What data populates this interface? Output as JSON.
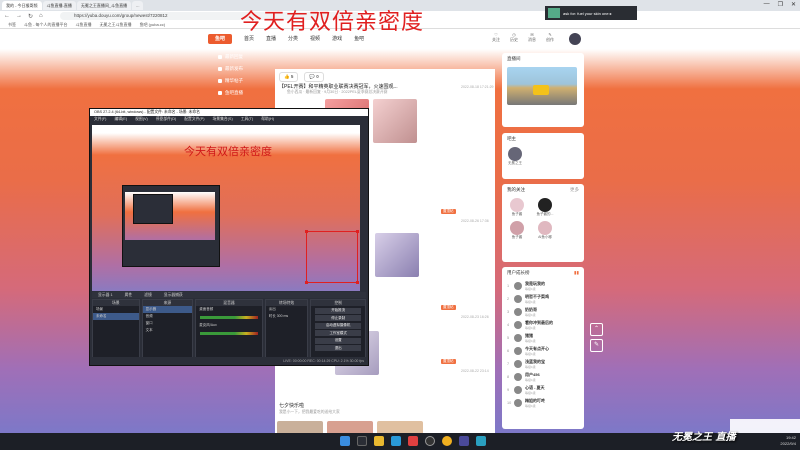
{
  "browser": {
    "tabs": [
      "我的 - 今日猴哥频",
      "斗鱼直播-直播",
      "无冕之王直播间_斗鱼直播",
      "..."
    ],
    "url": "https://yuba.douyu.com/group/newest/7220812",
    "bookmarks": [
      "书签",
      "斗鱼 - 每个人的直播平台",
      "斗鱼直播",
      "无冕之王斗鱼直播",
      "鱼吧 (yuba.cc)"
    ],
    "win_controls": [
      "—",
      "❐",
      "✕"
    ]
  },
  "overlay_title": "今天有双倍亲密度",
  "site": {
    "logo": "鱼吧",
    "nav": [
      "首页",
      "直播",
      "分类",
      "视频",
      "游戏",
      "鱼吧"
    ],
    "header_icons": [
      "关注",
      "历史",
      "消息",
      "创作"
    ],
    "leftnav": [
      "最新回复",
      "最新发布",
      "精华帖子",
      "鱼吧直播"
    ]
  },
  "banner": {
    "text": "ask for: fuel your skin one ▸"
  },
  "feed": {
    "pills": [
      "5",
      "0"
    ],
    "post_title": "【PEL开赛】和平精英职业联赛决赛冠军，火速围观...",
    "post_meta": "鱼小西瓜 · 最新回复 · 9月30日 · 2022PEL夏季赛总决赛开赛",
    "post_time": "2022-08-18 17:21:29",
    "tags": [
      {
        "label": "置顶帖",
        "time": "2022-08-26 17:36"
      },
      {
        "label": "置顶帖",
        "time": "2022-08-23 16:26"
      },
      {
        "label": "置顶帖",
        "time": "2022-08-22 23:14"
      }
    ],
    "bottom_title": "七夕快乐啦",
    "bottom_sub": "我是小一下，把我最爱吃的送给大家"
  },
  "right": {
    "live_title": "直播间",
    "anchor_title": "吧主",
    "anchor_name": "无冕之王",
    "follow_title": "我的关注",
    "follow_more": "更多",
    "follows": [
      "鱼子酱",
      "鱼子酱的...",
      "鱼子酱",
      "AI鱼小嘟"
    ],
    "hot_title": "用户成长榜",
    "hot": [
      {
        "name": "我是玩我的",
        "sub": "等级1级"
      },
      {
        "name": "明哲不子菜鸡",
        "sub": "等级1级"
      },
      {
        "name": "奶奶哥",
        "sub": "等级1级"
      },
      {
        "name": "看你冲到最后的",
        "sub": "等级1级"
      },
      {
        "name": "猪猪",
        "sub": "等级1级"
      },
      {
        "name": "今天有点开心",
        "sub": "等级1级"
      },
      {
        "name": "浅蓝我的宝",
        "sub": "等级1级"
      },
      {
        "name": "用户456",
        "sub": "等级1级"
      },
      {
        "name": "心语 - 夏天",
        "sub": "等级1级"
      },
      {
        "name": "梅姐的叮咚",
        "sub": "等级1级"
      },
      {
        "name": "猫01",
        "sub": "等级1级"
      }
    ]
  },
  "obs": {
    "title": "OBS 27.2.4 (64-bit, windows) - 配置文件: 未命名 - 场景: 未命名",
    "menu": [
      "文件(F)",
      "编辑(E)",
      "视图(V)",
      "停靠部件(D)",
      "配置文件(P)",
      "场景集合(S)",
      "工具(T)",
      "帮助(H)"
    ],
    "preview_title": "今天有双倍亲密度",
    "scenebar": [
      "显示器 1",
      "属性",
      "滤镜",
      "显示器捕获"
    ],
    "panels": {
      "scenes": "场景",
      "scene_items": [
        "场景",
        "未命名"
      ],
      "sources": "来源",
      "source_items": [
        "显示器",
        "音频",
        "窗口",
        "文本"
      ],
      "mixer": "混音器",
      "mixer_items": [
        "桌面音频",
        "麦克风/Aux"
      ],
      "transitions": "转场特效",
      "transition_items": [
        "淡出",
        "时长 300 ms"
      ],
      "controls": "控制",
      "control_buttons": [
        "开始推流",
        "停止录制",
        "启动虚拟摄像机",
        "工作室模式",
        "设置",
        "退出"
      ]
    },
    "status": "LIVE: 00:00:00  REC: 00:14:29  CPU: 2.1%  30.00 fps"
  },
  "taskbar": {
    "time": "19:42",
    "date": "2022/9/4"
  },
  "logo_watermark": "无冕之王 直播"
}
